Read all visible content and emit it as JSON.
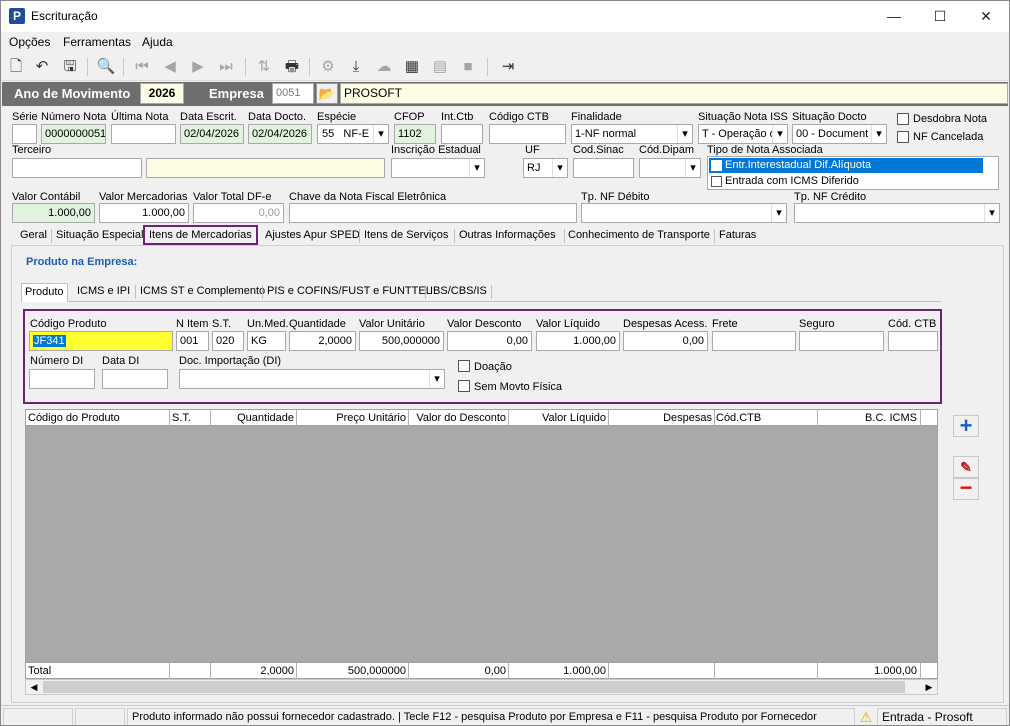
{
  "window": {
    "title": "Escrituração",
    "min": "—",
    "max": "☐",
    "close": "✕"
  },
  "menu": [
    "Opções",
    "Ferramentas",
    "Ajuda"
  ],
  "header": {
    "ano_label": "Ano de Movimento",
    "ano_value": "2026",
    "empresa_label": "Empresa",
    "empresa_code": "0051",
    "empresa_name": "PROSOFT"
  },
  "form": {
    "serie_label": "Série",
    "serie_value": "",
    "numero_label": "Número Nota",
    "numero_value": "0000000051",
    "ultima_label": "Última Nota",
    "ultima_value": "",
    "data_escrit_label": "Data Escrit.",
    "data_escrit_value": "02/04/2026",
    "data_docto_label": "Data Docto.",
    "data_docto_value": "02/04/2026",
    "especie_label": "Espécie",
    "especie_code": "55",
    "especie_value": "NF-E",
    "cfop_label": "CFOP",
    "cfop_value": "1102",
    "intctb_label": "Int.Ctb",
    "intctb_value": "",
    "codctb_label": "Código CTB",
    "codctb_value": "",
    "finalidade_label": "Finalidade",
    "finalidade_value": "1-NF normal",
    "sit_iss_label": "Situação Nota ISS",
    "sit_iss_value": "T - Operação d",
    "sit_docto_label": "Situação Docto",
    "sit_docto_value": "00 - Document",
    "desdobra_label": "Desdobra Nota",
    "nf_cancelada_label": "NF Cancelada",
    "terceiro_label": "Terceiro",
    "terceiro_value": "",
    "terceiro_nome": "",
    "ie_label": "Inscrição Estadual",
    "ie_value": "",
    "uf_label": "UF",
    "uf_value": "RJ",
    "sinac_label": "Cod.Sinac",
    "sinac_value": "",
    "dipam_label": "Cód.Dipam",
    "dipam_value": "",
    "tipo_assoc_label": "Tipo de Nota Associada",
    "tipo_assoc_items": [
      "Entr.Interestadual Dif.Alíquota",
      "Entrada com ICMS Diferido"
    ],
    "valor_contabil_label": "Valor Contábil",
    "valor_contabil_value": "1.000,00",
    "valor_merc_label": "Valor Mercadorias",
    "valor_merc_value": "1.000,00",
    "valor_dfe_label": "Valor Total DF-e",
    "valor_dfe_value": "0,00",
    "chave_label": "Chave da Nota Fiscal Eletrônica",
    "chave_value": "",
    "tp_debito_label": "Tp. NF Débito",
    "tp_debito_value": "",
    "tp_credito_label": "Tp. NF Crédito",
    "tp_credito_value": ""
  },
  "tabs": [
    "Geral",
    "Situação Especial",
    "Itens de Mercadorias",
    "Ajustes Apur SPED",
    "Itens de Serviços",
    "Outras Informações",
    "Conhecimento de Transporte",
    "Faturas"
  ],
  "produto_title": "Produto na Empresa:",
  "subtabs": [
    "Produto",
    "ICMS e IPI",
    "ICMS ST e Complemento",
    "PIS e COFINS/FUST e FUNTTEL",
    "IBS/CBS/IS"
  ],
  "item": {
    "cod_produto_label": "Código Produto",
    "cod_produto_value": "JF341",
    "n_item_label": "N Item",
    "n_item_value": "001",
    "st_label": "S.T.",
    "st_value": "020",
    "un_label": "Un.Med.",
    "un_value": "KG",
    "quantidade_label": "Quantidade",
    "quantidade_value": "2,0000",
    "valor_unit_label": "Valor Unitário",
    "valor_unit_value": "500,000000",
    "valor_desc_label": "Valor Desconto",
    "valor_desc_value": "0,00",
    "valor_liq_label": "Valor Líquido",
    "valor_liq_value": "1.000,00",
    "despesas_label": "Despesas Acess.",
    "despesas_value": "0,00",
    "frete_label": "Frete",
    "frete_value": "",
    "seguro_label": "Seguro",
    "seguro_value": "",
    "cod_ctb_label": "Cód. CTB",
    "cod_ctb_value": "",
    "numero_di_label": "Número DI",
    "numero_di_value": "",
    "data_di_label": "Data DI",
    "data_di_value": "",
    "doc_import_label": "Doc. Importação (DI)",
    "doc_import_value": "",
    "doacao_label": "Doação",
    "sem_movto_label": "Sem Movto Física"
  },
  "grid": {
    "columns": [
      "Código do Produto",
      "S.T.",
      "Quantidade",
      "Preço Unitário",
      "Valor do Desconto",
      "Valor Líquido",
      "Despesas",
      "Cód.CTB",
      "B.C. ICMS"
    ],
    "totals": {
      "label": "Total",
      "quantidade": "2,0000",
      "preco": "500,000000",
      "desconto": "0,00",
      "liquido": "1.000,00",
      "bc_icms": "1.000,00"
    }
  },
  "side_buttons": {
    "add": "+",
    "edit": "✎",
    "remove": "−"
  },
  "status": {
    "message": "Produto informado não possui fornecedor cadastrado. | Tecle F12 - pesquisa Produto por Empresa e F11 - pesquisa Produto por Fornecedor",
    "mode": "Entrada - Prosoft"
  },
  "colors": {
    "highlight_border": "#6b2471",
    "selected_blue": "#0078d7",
    "yellow_input": "#ffff33",
    "green_input": "#dff3df"
  }
}
